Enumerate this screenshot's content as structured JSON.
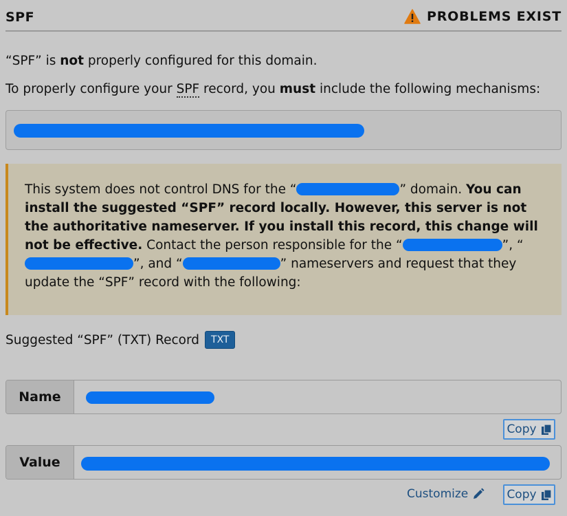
{
  "header": {
    "title": "SPF",
    "status": "PROBLEMS EXIST",
    "status_icon": "warning-triangle-icon",
    "status_color": "#e07a10"
  },
  "intro": {
    "line1_a": "“SPF” is ",
    "line1_b": "not",
    "line1_c": " properly configured for this domain.",
    "line2_a": "To properly configure your ",
    "line2_abbr": "SPF",
    "line2_b": " record, you ",
    "line2_must": "must",
    "line2_c": " include the following mechanisms:"
  },
  "notice": {
    "t1": "This system does not control DNS for the “",
    "t2": "” domain. ",
    "bold": "You can install the suggested “SPF” record locally. However, this server is not the authoritative nameserver. If you install this record, this change will not be effective.",
    "t3": " Contact the person responsible for the “",
    "t4": "”, “",
    "t5": "”, and “",
    "t6": "” nameservers and request that they update the “SPF” record with the following:",
    "accent_color": "#c8881e"
  },
  "suggested": {
    "label": "Suggested “SPF” (TXT) Record",
    "badge": "TXT"
  },
  "fields": {
    "name_label": "Name",
    "value_label": "Value"
  },
  "actions": {
    "copy_label": "Copy",
    "customize_label": "Customize"
  }
}
